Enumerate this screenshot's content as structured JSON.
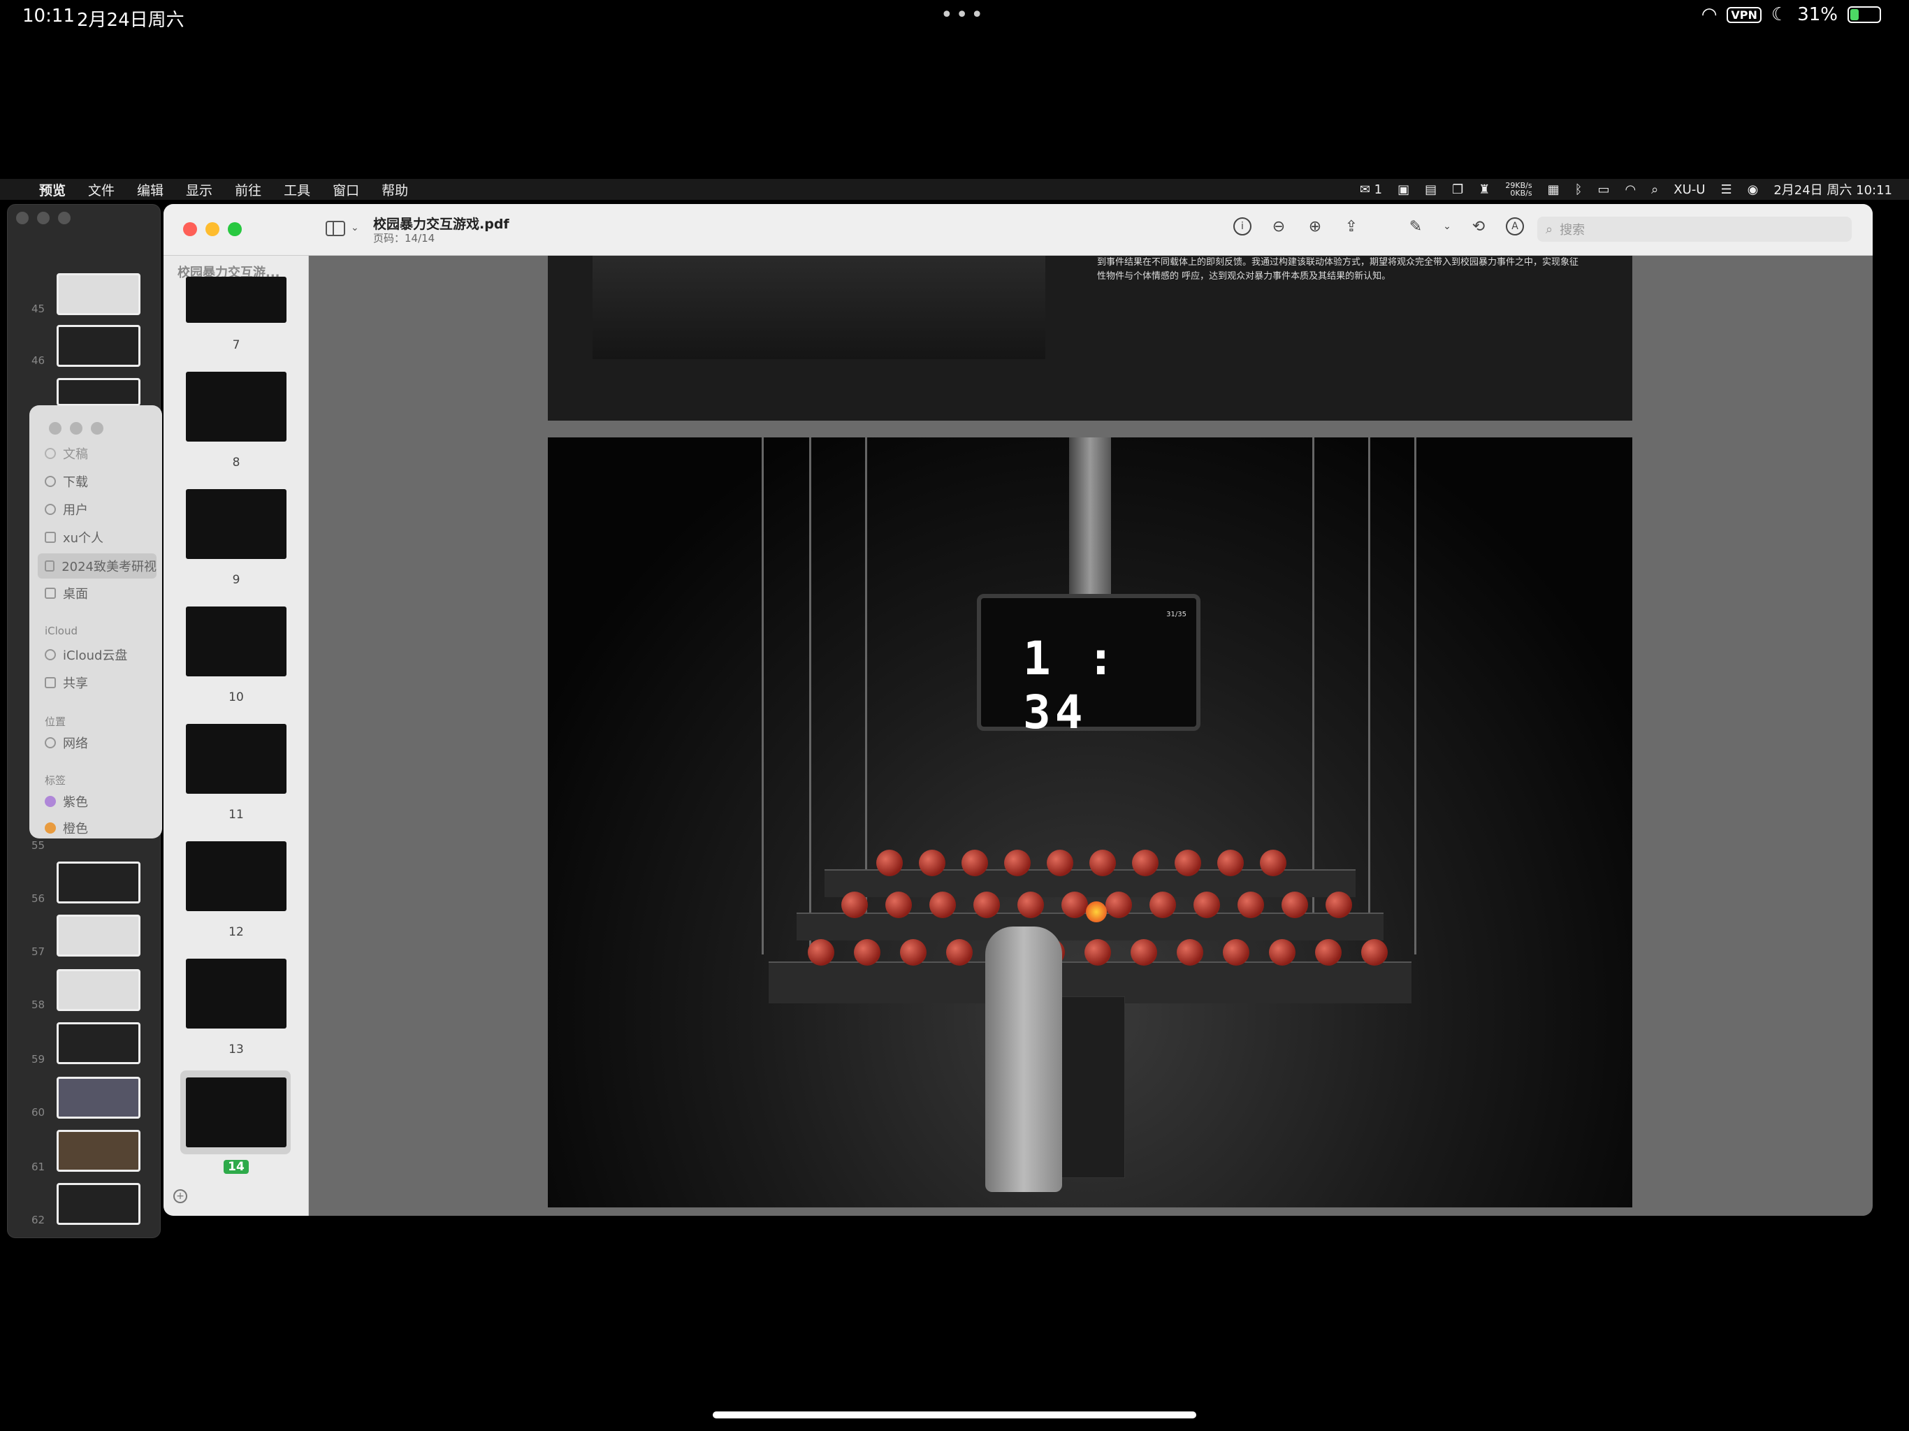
{
  "ipad_status": {
    "time": "10:11",
    "date": "2月24日周六",
    "vpn": "VPN",
    "battery": "31%",
    "battery_level": 0.31
  },
  "menubar": {
    "items": [
      "预览",
      "文件",
      "编辑",
      "显示",
      "前往",
      "工具",
      "窗口",
      "帮助"
    ],
    "wechat_count": "1",
    "net_up": "29KB/s",
    "net_down": "0KB/s",
    "user": "XU-U",
    "datetime": "2月24日 周六 10:11"
  },
  "finder_back": {
    "page_numbers": [
      "45",
      "46",
      "55",
      "56",
      "57",
      "58",
      "59",
      "60",
      "61",
      "62"
    ]
  },
  "finder_sidebar": {
    "items": [
      "文稿",
      "下载",
      "用户",
      "xu个人",
      "2024致美考研视",
      "桌面"
    ],
    "icloud_header": "iCloud",
    "icloud_items": [
      "iCloud云盘",
      "共享"
    ],
    "location_header": "位置",
    "location_items": [
      "网络"
    ],
    "tags_header": "标签",
    "tags": [
      {
        "label": "紫色",
        "color": "#b58be0"
      },
      {
        "label": "橙色",
        "color": "#f0a040"
      }
    ]
  },
  "preview": {
    "title": "校园暴力交互游戏.pdf",
    "page_info": "页码：14/14",
    "sidebar_header": "校园暴力交互游...",
    "search_placeholder": "搜索",
    "thumbnails": [
      "7",
      "8",
      "9",
      "10",
      "11",
      "12",
      "13",
      "14"
    ],
    "selected_page": "14",
    "caption": "到事件结果在不同载体上的即刻反馈。我通过构建该联动体验方式，期望将观众完全带入到校园暴力事件之中，实现象征性物件与个体情感的 呼应，达到观众对暴力事件本质及其结果的新认知。"
  },
  "scene": {
    "clock": "1 : 34",
    "counter": "31/35"
  }
}
